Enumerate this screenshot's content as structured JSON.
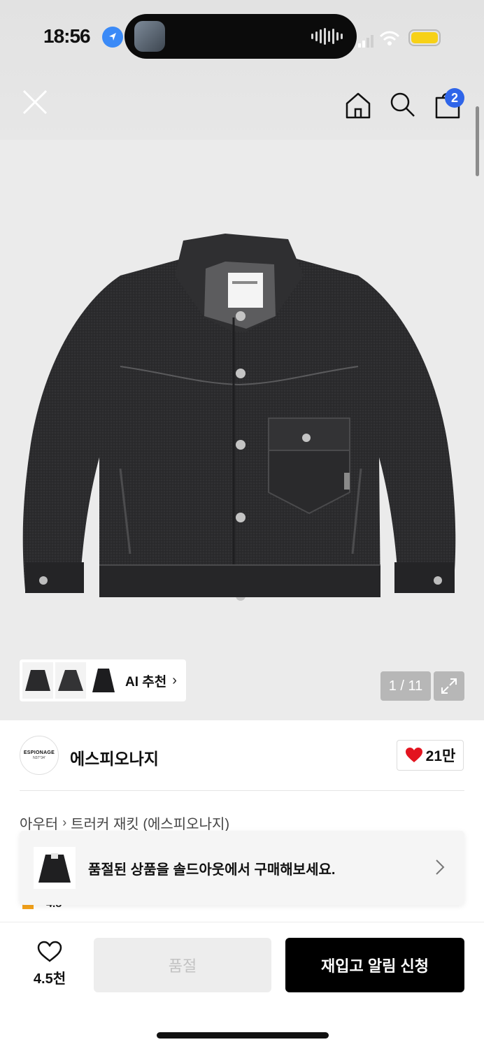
{
  "status_bar": {
    "time": "18:56"
  },
  "header": {
    "cart_count": "2"
  },
  "gallery": {
    "ai_label": "AI 추천",
    "pager": "1 / 11"
  },
  "brand": {
    "logo_text": "ESPIONAGE",
    "logo_sub": "N37°34'",
    "name": "에스피오나지",
    "likes": "21만"
  },
  "breadcrumb": {
    "category": "아우터",
    "product": "트러커 재킷 (에스피오나지)"
  },
  "rating_peek": "4.8",
  "soldout_banner": {
    "text": "품절된 상품을 솔드아웃에서 구매해보세요."
  },
  "bottom_bar": {
    "wish_count": "4.5천",
    "soldout_label": "품절",
    "restock_label": "재입고 알림 신청"
  },
  "colors": {
    "accent_blue": "#2f65e9",
    "heart_red": "#e3141f",
    "battery": "#f7d117"
  }
}
